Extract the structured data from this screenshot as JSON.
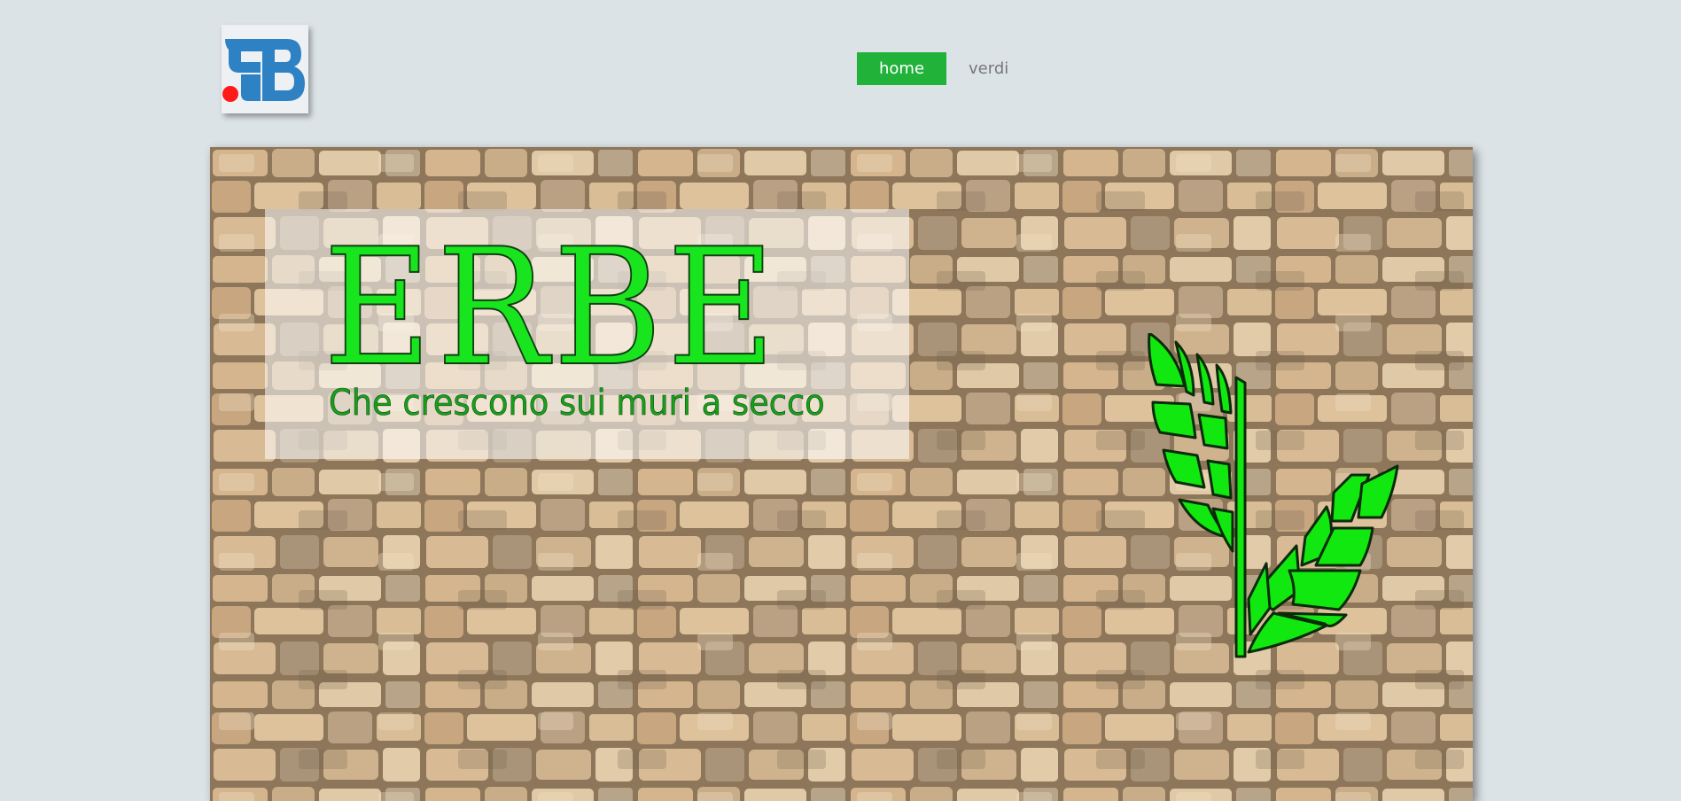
{
  "logo": {
    "icon": "fb-logo-icon",
    "colors": {
      "blue": "#2e82c4",
      "red": "#ff1a1a"
    }
  },
  "nav": {
    "items": [
      {
        "label": "home",
        "active": true
      },
      {
        "label": "verdi",
        "active": false
      }
    ],
    "active_color": "#21b23a"
  },
  "hero": {
    "title": "ERBE",
    "subtitle": "Che crescono sui muri a secco",
    "background": "dry-stone-wall",
    "emblem": "wheat-leaf-icon",
    "title_color": "#19e51f"
  }
}
